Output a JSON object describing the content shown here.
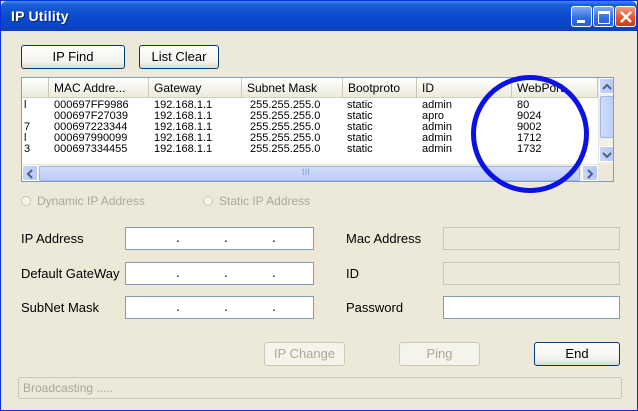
{
  "window": {
    "title": "IP Utility",
    "title_icon": "title-icon"
  },
  "toolbar": {
    "ip_find_label": "IP Find",
    "list_clear_label": "List Clear"
  },
  "list": {
    "columns": [
      "",
      "MAC Addre...",
      "Gateway",
      "Subnet Mask",
      "Bootproto",
      "ID",
      "WebPort"
    ],
    "rows": [
      {
        "index": "l",
        "mac": "000697FF9986",
        "gateway": "192.168.1.1",
        "subnet": "255.255.255.0",
        "boot": "static",
        "id": "admin",
        "webport": "80"
      },
      {
        "index": "",
        "mac": "000697F27039",
        "gateway": "192.168.1.1",
        "subnet": "255.255.255.0",
        "boot": "static",
        "id": "apro",
        "webport": "9024"
      },
      {
        "index": "7",
        "mac": "000697223344",
        "gateway": "192.168.1.1",
        "subnet": "255.255.255.0",
        "boot": "static",
        "id": "admin",
        "webport": "9002"
      },
      {
        "index": "l",
        "mac": "000697990099",
        "gateway": "192.168.1.1",
        "subnet": "255.255.255.0",
        "boot": "static",
        "id": "admin",
        "webport": "1712"
      },
      {
        "index": "3",
        "mac": "000697334455",
        "gateway": "192.168.1.1",
        "subnet": "255.255.255.0",
        "boot": "static",
        "id": "admin",
        "webport": "1732"
      }
    ],
    "scroll_hint": "III"
  },
  "radios": {
    "dynamic_label": "Dynamic IP Address",
    "static_label": "Static IP Address"
  },
  "form": {
    "ip_address_label": "IP Address",
    "default_gateway_label": "Default GateWay",
    "subnet_mask_label": "SubNet Mask",
    "mac_address_label": "Mac Address",
    "id_label": "ID",
    "password_label": "Password",
    "ip_dots": "."
  },
  "actions": {
    "ip_change_label": "IP Change",
    "ping_label": "Ping",
    "end_label": "End"
  },
  "status": {
    "text": "Broadcasting ....."
  },
  "colors": {
    "annotation_circle": "#0a12e6",
    "titlebar": "#0a4ad0",
    "window_bg": "#ece9d8"
  }
}
